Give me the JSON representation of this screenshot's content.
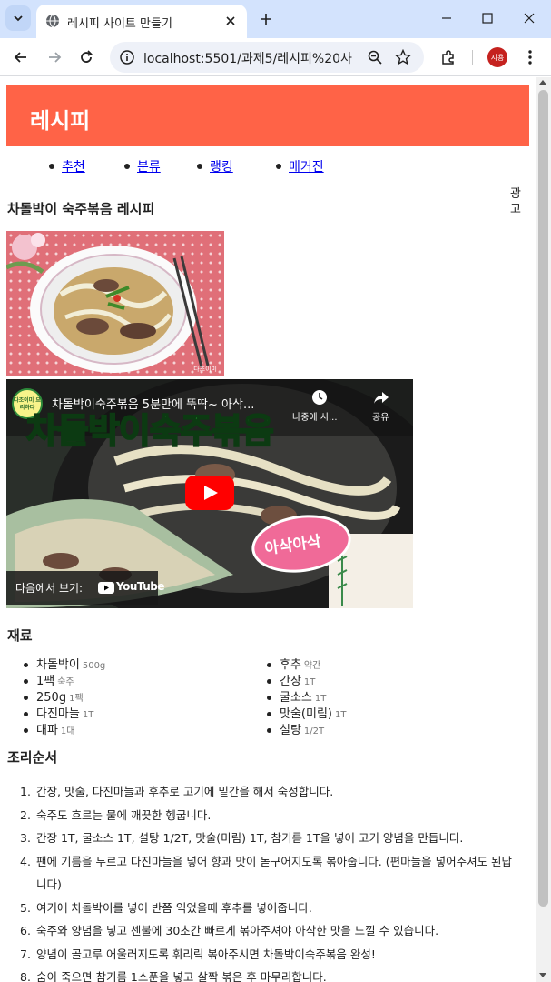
{
  "browser": {
    "tab_title": "레시피 사이트 만들기",
    "url": "localhost:5501/과제5/레시피%20사...",
    "profile_initial": "지용"
  },
  "page": {
    "site_title": "레시피",
    "nav": [
      "추천",
      "분류",
      "랭킹",
      "매거진"
    ],
    "ad_label": "광고",
    "recipe_title": "차돌박이 숙주볶음 레시피",
    "video": {
      "channel_badge": "다조이미 요리하다",
      "title": "차돌박이숙주볶음 5분만에 뚝딱~ 아삭...",
      "watch_later": "나중에 시...",
      "share": "공유",
      "banner_text": "차돌박이숙주볶음",
      "bubble_text": "아삭아삭",
      "watch_on": "다음에서 보기:",
      "youtube": "YouTube"
    },
    "photo_watermark": "다조이미",
    "ingredients_heading": "재료",
    "ingredients_left": [
      {
        "name": "차돌박이",
        "qty": "500g"
      },
      {
        "name": "1팩",
        "qty": "숙주"
      },
      {
        "name": "250g",
        "qty": "1팩"
      },
      {
        "name": "다진마늘",
        "qty": "1T"
      },
      {
        "name": "대파",
        "qty": "1대"
      }
    ],
    "ingredients_right": [
      {
        "name": "후추",
        "qty": "약간"
      },
      {
        "name": "간장",
        "qty": "1T"
      },
      {
        "name": "굴소스",
        "qty": "1T"
      },
      {
        "name": "맛술(미림)",
        "qty": "1T"
      },
      {
        "name": "설탕",
        "qty": "1/2T"
      }
    ],
    "steps_heading": "조리순서",
    "steps": [
      "간장, 맛술, 다진마늘과 후추로 고기에 밑간을 해서 숙성합니다.",
      "숙주도 흐르는 물에 깨끗한 헹굽니다.",
      "간장 1T, 굴소스 1T, 설탕 1/2T, 맛술(미림) 1T, 참기름 1T을 넣어 고기 양념을 만듭니다.",
      "팬에 기름을 두르고 다진마늘을 넣어 향과 맛이 돋구어지도록 볶아줍니다. (편마늘을 넣어주셔도 된답니다)",
      "여기에 차돌박이를 넣어 반쯤 익었을때 후추를 넣어줍니다.",
      "숙주와 양념을 넣고 센불에 30초간 빠르게 볶아주셔야 아삭한 맛을 느낄 수 있습니다.",
      "양념이 골고루 어울러지도록 휘리릭 볶아주시면 차돌박이숙주볶음 완성!",
      "숨이 죽으면 참기름 1스푼을 넣고 살짝 볶은 후 마무리합니다."
    ]
  },
  "colors": {
    "header_bg": "#ff6347",
    "link": "#0000ee",
    "tab_strip": "#d3e3fd",
    "video_banner_text": "#29d13a",
    "bubble": "#f06a98",
    "youtube_red": "#ff0000"
  },
  "icons": [
    "tab-list-icon",
    "globe-icon",
    "close-icon",
    "plus-icon",
    "minimize-icon",
    "maximize-icon",
    "window-close-icon",
    "back-icon",
    "forward-icon",
    "reload-icon",
    "info-icon",
    "zoom-icon",
    "star-icon",
    "extensions-icon",
    "menu-icon",
    "play-icon",
    "clock-icon",
    "share-icon"
  ]
}
